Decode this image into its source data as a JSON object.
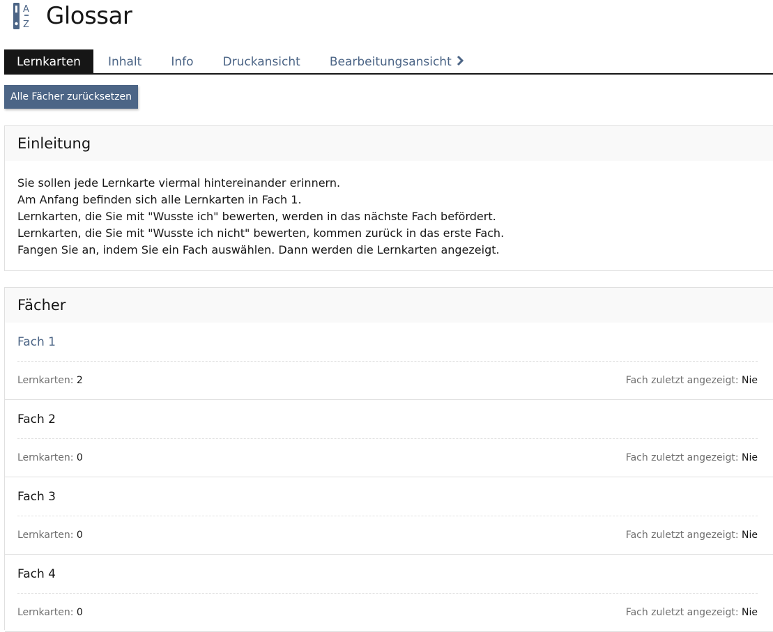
{
  "header": {
    "title": "Glossar",
    "icon": "glossary-az-icon"
  },
  "tabs": [
    {
      "label": "Lernkarten",
      "active": true
    },
    {
      "label": "Inhalt"
    },
    {
      "label": "Info"
    },
    {
      "label": "Druckansicht"
    },
    {
      "label": "Bearbeitungsansicht",
      "icon": "chevron-right-icon"
    }
  ],
  "toolbar": {
    "reset_label": "Alle Fächer zurücksetzen"
  },
  "intro": {
    "heading": "Einleitung",
    "lines": [
      "Sie sollen jede Lernkarte viermal hintereinander erinnern.",
      "Am Anfang befinden sich alle Lernkarten in Fach 1.",
      "Lernkarten, die Sie mit \"Wusste ich\" bewerten, werden in das nächste Fach befördert.",
      "Lernkarten, die Sie mit \"Wusste ich nicht\" bewerten, kommen zurück in das erste Fach.",
      "Fangen Sie an, indem Sie ein Fach auswählen. Dann werden die Lernkarten angezeigt."
    ]
  },
  "faecher": {
    "heading": "Fächer",
    "count_label": "Lernkarten:",
    "last_shown_label": "Fach zuletzt angezeigt:",
    "items": [
      {
        "title": "Fach 1",
        "count": "2",
        "last_shown": "Nie"
      },
      {
        "title": "Fach 2",
        "count": "0",
        "last_shown": "Nie"
      },
      {
        "title": "Fach 3",
        "count": "0",
        "last_shown": "Nie"
      },
      {
        "title": "Fach 4",
        "count": "0",
        "last_shown": "Nie"
      }
    ]
  },
  "colors": {
    "accent": "#4c6586",
    "text": "#161616",
    "muted": "#6f6f6f"
  }
}
